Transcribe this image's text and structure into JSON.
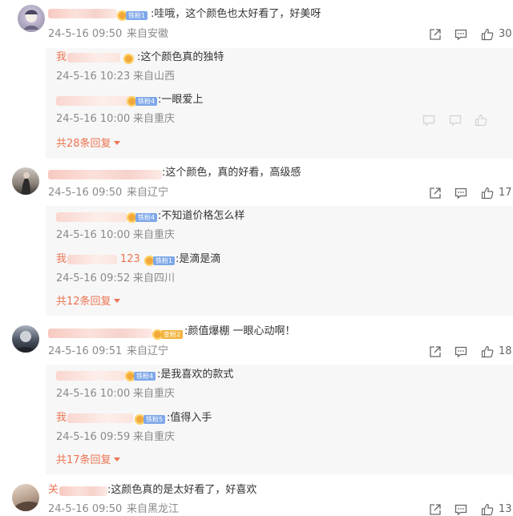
{
  "comments": [
    {
      "name_prefix": "",
      "fan_badge": "铁粉1",
      "text": ":哇哦，这个颜色也太好看了，好美呀",
      "time": "24-5-16 09:50",
      "location": "来自安徽",
      "likes": "30",
      "replies": [
        {
          "name_prefix": "我",
          "fan_badge": "",
          "text": ":这个颜色真的独特",
          "time": "24-5-16 10:23",
          "location": "来自山西"
        },
        {
          "name_prefix": "",
          "fan_badge": "铁粉4",
          "text": ":一眼爱上",
          "time": "24-5-16 10:00",
          "location": "来自重庆"
        }
      ],
      "more_replies": "共28条回复"
    },
    {
      "name_prefix": "",
      "fan_badge": "",
      "text": ":这个颜色，真的好看，高级感",
      "time": "24-5-16 09:50",
      "location": "来自辽宁",
      "likes": "17",
      "replies": [
        {
          "name_prefix": "",
          "fan_badge": "铁粉4",
          "text": ":不知道价格怎么样",
          "time": "24-5-16 10:00",
          "location": "来自重庆"
        },
        {
          "name_prefix": "我",
          "name_suffix": "123",
          "fan_badge": "铁粉1",
          "text": ":是滴是滴",
          "time": "24-5-16 09:52",
          "location": "来自四川"
        }
      ],
      "more_replies": "共12条回复"
    },
    {
      "name_prefix": "",
      "fan_badge": "金粉2",
      "text": ":颜值爆棚 一眼心动啊！",
      "time": "24-5-16 09:51",
      "location": "来自辽宁",
      "likes": "18",
      "replies": [
        {
          "name_prefix": "",
          "fan_badge": "铁粉4",
          "text": ":是我喜欢的款式",
          "time": "24-5-16 10:00",
          "location": "来自重庆"
        },
        {
          "name_prefix": "我",
          "fan_badge": "铁粉5",
          "text": ":值得入手",
          "time": "24-5-16 09:59",
          "location": "来自重庆"
        }
      ],
      "more_replies": "共17条回复"
    },
    {
      "name_prefix": "关",
      "fan_badge": "",
      "text": ":这颜色真的是太好看了，好喜欢",
      "time": "24-5-16 09:50",
      "location": "来自黑龙江",
      "likes": "13",
      "replies": [],
      "more_replies": ""
    }
  ],
  "icons": {
    "share": "share-icon",
    "comment": "comment-icon",
    "like": "like-icon"
  },
  "colors": {
    "accent": "#eb7350",
    "meta": "#8a8a8a",
    "reply_bg": "#f7f7f7"
  }
}
